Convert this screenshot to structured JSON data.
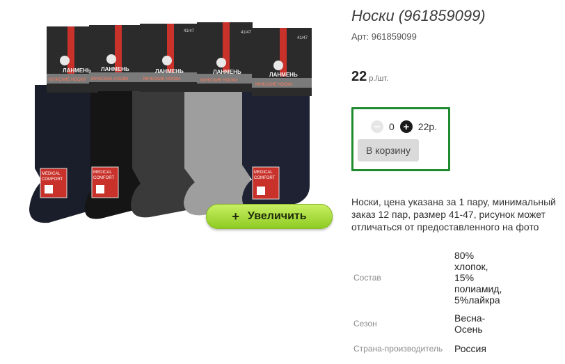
{
  "product": {
    "title": "Носки (961859099)",
    "sku": "Арт: 961859099",
    "price": "22",
    "price_unit": " р./шт."
  },
  "image": {
    "zoom_label": "Увеличить",
    "brand_text": "ЛАНМЕНЬ",
    "tag_text": "МУЖСКИЕ НОСКИ",
    "size_text": "41/47",
    "badge_line1": "MEDICAL",
    "badge_line2": "COMFORT"
  },
  "cart": {
    "quantity": "0",
    "sum": "22р.",
    "button": "В корзину"
  },
  "description": "Носки, цена указана за 1 пару, минимальный заказ 12 пар, размер 41-47, рисунок может отличаться от предоставленного на фото",
  "specs": [
    {
      "key": "Состав",
      "value": "80% хлопок, 15% полиамид, 5%лайкра"
    },
    {
      "key": "Сезон",
      "value": "Весна-Осень"
    },
    {
      "key": "Страна-производитель",
      "value": "Россия"
    }
  ],
  "colors": {
    "accent_green": "#1f8a2e",
    "zoom_button": "#a8dd3a",
    "sock_colors": [
      "#1a1d2a",
      "#151515",
      "#3a3a3a",
      "#9e9e9e",
      "#1e2233"
    ]
  }
}
